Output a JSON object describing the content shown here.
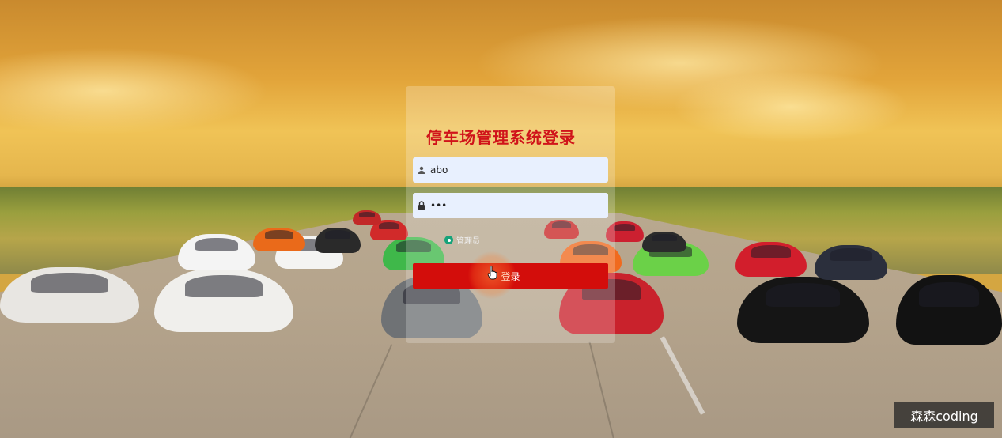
{
  "login": {
    "title": "停车场管理系统登录",
    "username": {
      "value": "abo",
      "icon": "user-icon"
    },
    "password": {
      "value": "•••",
      "icon": "lock-icon"
    },
    "role_option": {
      "label": "管理员",
      "selected": true
    },
    "submit_label": "登录"
  },
  "watermark": "森森coding",
  "colors": {
    "title_red": "#d0141a",
    "button_red": "#d30d0b",
    "input_bg": "#e8f0fe",
    "radio_green": "#16a37a"
  }
}
